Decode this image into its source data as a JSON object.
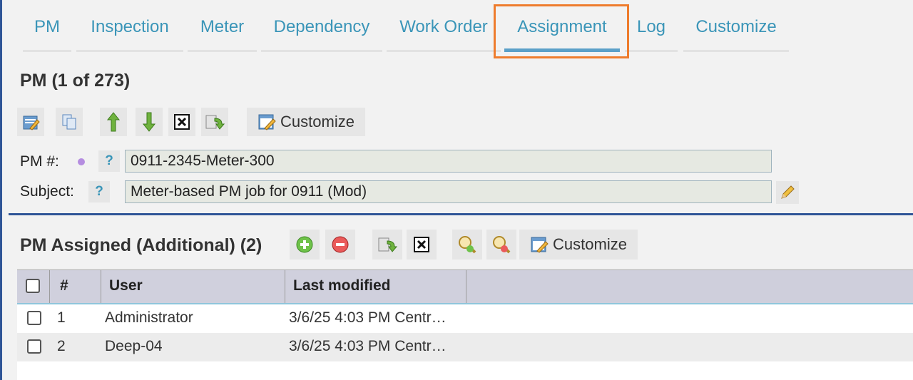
{
  "tabs": [
    "PM",
    "Inspection",
    "Meter",
    "Dependency",
    "Work Order",
    "Assignment",
    "Log",
    "Customize"
  ],
  "active_tab": "Assignment",
  "pm_section": {
    "title": "PM (1 of 273)",
    "toolbar": {
      "customize_label": "Customize"
    },
    "fields": {
      "pm_number_label": "PM #:",
      "pm_number_value": "0911-2345-Meter-300",
      "subject_label": "Subject:",
      "subject_value": "Meter-based PM job for 0911 (Mod)",
      "help_glyph": "?"
    }
  },
  "assigned_section": {
    "title": "PM Assigned (Additional) (2)",
    "toolbar": {
      "customize_label": "Customize"
    },
    "columns": [
      "#",
      "User",
      "Last modified"
    ],
    "rows": [
      {
        "num": "1",
        "user": "Administrator",
        "modified": "3/6/25 4:03 PM Centr…"
      },
      {
        "num": "2",
        "user": "Deep-04",
        "modified": "3/6/25 4:03 PM Centr…"
      }
    ]
  },
  "colors": {
    "tab_text": "#3a95b8",
    "highlight": "#ee7c2d",
    "divider": "#2f5597"
  },
  "icons": [
    "edit-icon",
    "copy-icon",
    "arrow-up-icon",
    "arrow-down-icon",
    "delete-icon",
    "refresh-icon",
    "customize-icon",
    "add-icon",
    "remove-icon",
    "zoom-in-icon",
    "zoom-out-icon",
    "pencil-icon"
  ]
}
